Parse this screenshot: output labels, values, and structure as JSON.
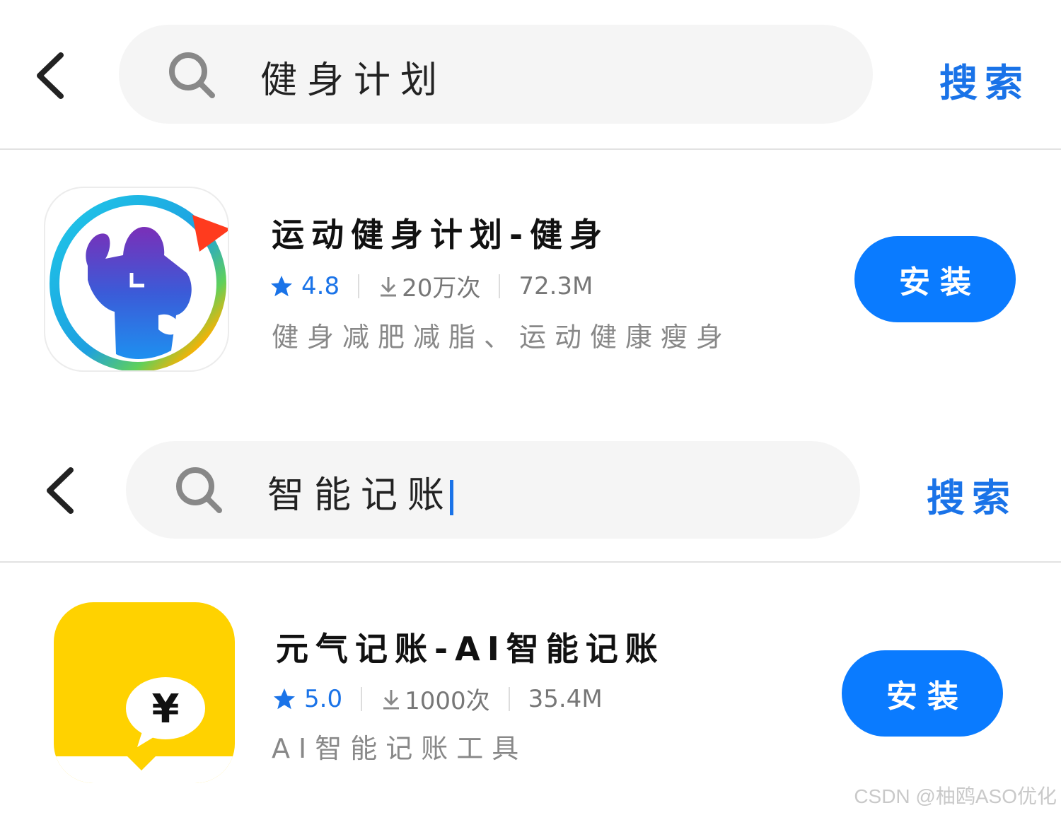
{
  "colors": {
    "accent": "#1a73e8",
    "install_bg": "#0a7bff",
    "search_bg": "#f5f5f5",
    "divider": "#e2e2e2",
    "app2_icon_bg": "#ffd200"
  },
  "panels": [
    {
      "search": {
        "query": "健身计划",
        "button_label": "搜索",
        "back_icon": "chevron-left-icon",
        "search_icon": "search-icon"
      },
      "result": {
        "name": "运动健身计划-健身",
        "rating": "4.8",
        "downloads": "20万次",
        "size": "72.3M",
        "description": "健身减肥减脂、运动健康瘦身",
        "install_label": "安装",
        "icon": "bodybuilder-icon"
      }
    },
    {
      "search": {
        "query": "智能记账",
        "button_label": "搜索",
        "back_icon": "chevron-left-icon",
        "search_icon": "search-icon",
        "caret": true
      },
      "result": {
        "name": "元气记账-AI智能记账",
        "rating": "5.0",
        "downloads": "1000次",
        "size": "35.4M",
        "description": "AI智能记账工具",
        "install_label": "安装",
        "icon": "yen-speech-bubble-icon"
      }
    }
  ],
  "watermark": "CSDN @柚鸥ASO优化"
}
